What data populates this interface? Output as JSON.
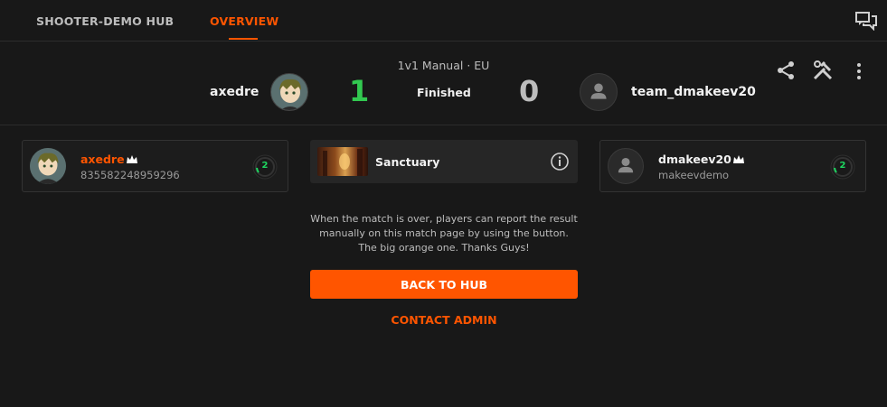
{
  "nav": {
    "tabs": [
      {
        "label": "SHOOTER-DEMO HUB",
        "active": false
      },
      {
        "label": "OVERVIEW",
        "active": true
      }
    ],
    "chat_icon": "chat-bubbles-icon",
    "accent_color": "#ff5500"
  },
  "match": {
    "mode": "1v1 Manual · EU",
    "status": "Finished",
    "team1": {
      "name": "axedre",
      "score": "1",
      "score_color": "#32c850"
    },
    "team2": {
      "name": "team_dmakeev20",
      "score": "0",
      "score_color": "#bdbdbd"
    },
    "actions": [
      "share-icon",
      "tools-icon",
      "more-vertical-icon"
    ]
  },
  "players": {
    "left": {
      "nickname": "axedre",
      "id": "835582248959296",
      "level": "2",
      "crown": true
    },
    "right": {
      "nickname": "dmakeev20",
      "id": "makeevdemo",
      "level": "2",
      "crown": true
    }
  },
  "map": {
    "name": "Sanctuary",
    "info_icon": "info-icon"
  },
  "notice": "When the match is over, players can report the result manually on this match page by using the button. The big orange one. Thanks Guys!",
  "buttons": {
    "back_to_hub": "BACK TO HUB",
    "contact_admin": "CONTACT ADMIN"
  }
}
